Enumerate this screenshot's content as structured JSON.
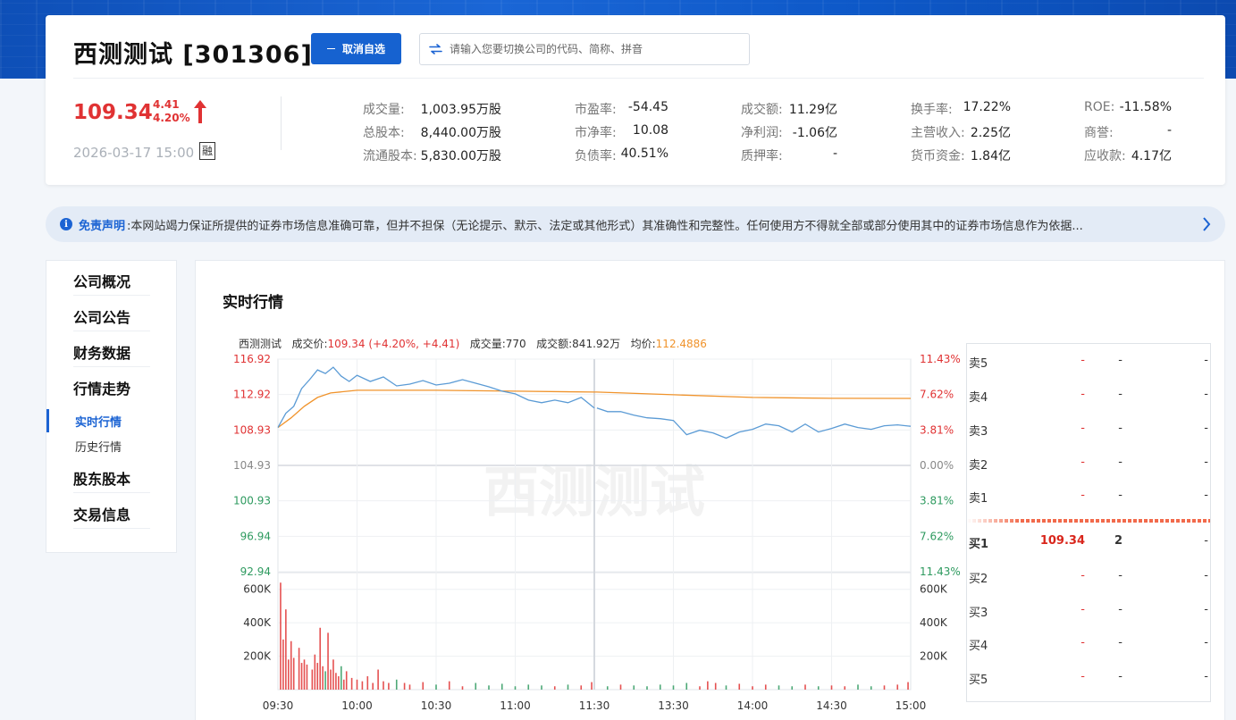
{
  "header": {
    "title": "西测测试 [301306]",
    "cancel_label": "取消自选",
    "search_placeholder": "请输入您要切换公司的代码、简称、拼音"
  },
  "quote": {
    "price": "109.34",
    "change": "4.41",
    "change_pct": "4.20%",
    "datetime": "2026-03-17 15:00",
    "margin_badge": "融"
  },
  "metrics": [
    [
      {
        "label": "成交量:",
        "value": "1,003.95万股"
      },
      {
        "label": "总股本:",
        "value": "8,440.00万股"
      },
      {
        "label": "流通股本:",
        "value": "5,830.00万股"
      }
    ],
    [
      {
        "label": "市盈率:",
        "value": "-54.45"
      },
      {
        "label": "市净率:",
        "value": "10.08"
      },
      {
        "label": "负债率:",
        "value": "40.51%"
      }
    ],
    [
      {
        "label": "成交额:",
        "value": "11.29亿"
      },
      {
        "label": "净利润:",
        "value": "-1.06亿"
      },
      {
        "label": "质押率:",
        "value": "-"
      }
    ],
    [
      {
        "label": "换手率:",
        "value": "17.22%"
      },
      {
        "label": "主营收入:",
        "value": "2.25亿"
      },
      {
        "label": "货币资金:",
        "value": "1.84亿"
      }
    ],
    [
      {
        "label": "ROE:",
        "value": "-11.58%"
      },
      {
        "label": "商誉:",
        "value": "-"
      },
      {
        "label": "应收款:",
        "value": "4.17亿"
      }
    ]
  ],
  "notice": {
    "title": "免责声明",
    "text": ":本网站竭力保证所提供的证券市场信息准确可靠，但并不担保（无论提示、默示、法定或其他形式）其准确性和完整性。任何使用方不得就全部或部分使用其中的证券市场信息作为依据..."
  },
  "sidebar": {
    "items": [
      "公司概况",
      "公司公告",
      "财务数据",
      "行情走势",
      "股东股本",
      "交易信息"
    ],
    "subitems": [
      "实时行情",
      "历史行情"
    ]
  },
  "main": {
    "section_title": "实时行情",
    "info": {
      "name": "西测测试",
      "price_label": "成交价:",
      "price_value": "109.34 (+4.20%, +4.41)",
      "volume_label": "成交量:",
      "volume_value": "770",
      "amount_label": "成交额:",
      "amount_value": "841.92万",
      "avg_label": "均价:",
      "avg_value": "112.4886"
    },
    "watermark": "西测测试"
  },
  "colors": {
    "up": "#e03233",
    "down": "#2e9a5f",
    "accent": "#1b63d3",
    "price_line": "#5b9bd5",
    "avg_line": "#f0932b"
  },
  "icons": [
    "arrow-up-icon",
    "swap-icon",
    "minus-icon",
    "info-icon",
    "chevron-right-icon"
  ],
  "chart_data": {
    "type": "line",
    "price_axis": {
      "labels": [
        "116.92",
        "112.92",
        "108.93",
        "104.93",
        "100.93",
        "96.94",
        "92.94"
      ],
      "ylim": [
        92.94,
        116.92
      ],
      "base": 104.93
    },
    "pct_axis": {
      "labels": [
        "11.43%",
        "7.62%",
        "3.81%",
        "0.00%",
        "3.81%",
        "7.62%",
        "11.43%"
      ]
    },
    "volume_axis": {
      "labels": [
        "600K",
        "400K",
        "200K"
      ],
      "ylim": [
        0,
        700000
      ]
    },
    "x_labels": [
      "09:30",
      "10:00",
      "10:30",
      "11:00",
      "11:30",
      "13:30",
      "14:00",
      "14:30",
      "15:00"
    ],
    "series": [
      {
        "type": "line",
        "values": [
          [
            0,
            109.2
          ],
          [
            3,
            110.8
          ],
          [
            6,
            111.6
          ],
          [
            9,
            113.6
          ],
          [
            12,
            114.6
          ],
          [
            15,
            115.7
          ],
          [
            18,
            115.3
          ],
          [
            21,
            116.0
          ],
          [
            24,
            115.0
          ],
          [
            27,
            114.4
          ],
          [
            30,
            115.1
          ],
          [
            35,
            114.4
          ],
          [
            40,
            114.9
          ],
          [
            45,
            113.9
          ],
          [
            50,
            114.1
          ],
          [
            55,
            114.5
          ],
          [
            60,
            114.0
          ],
          [
            65,
            114.2
          ],
          [
            70,
            114.6
          ],
          [
            75,
            114.2
          ],
          [
            80,
            113.8
          ],
          [
            85,
            113.3
          ],
          [
            90,
            113.0
          ],
          [
            95,
            112.3
          ],
          [
            100,
            112.0
          ],
          [
            105,
            112.3
          ],
          [
            110,
            112.0
          ],
          [
            115,
            112.6
          ],
          [
            120,
            111.4
          ],
          [
            121,
            111.4
          ],
          [
            125,
            111.0
          ],
          [
            130,
            111.0
          ],
          [
            135,
            110.6
          ],
          [
            140,
            110.3
          ],
          [
            145,
            110.2
          ],
          [
            150,
            110.0
          ],
          [
            155,
            108.4
          ],
          [
            160,
            108.9
          ],
          [
            165,
            108.6
          ],
          [
            170,
            108.0
          ],
          [
            175,
            108.7
          ],
          [
            180,
            109.0
          ],
          [
            185,
            109.6
          ],
          [
            190,
            109.4
          ],
          [
            195,
            108.7
          ],
          [
            200,
            109.6
          ],
          [
            205,
            108.7
          ],
          [
            210,
            109.1
          ],
          [
            215,
            109.6
          ],
          [
            220,
            109.2
          ],
          [
            225,
            109.0
          ],
          [
            230,
            109.4
          ],
          [
            235,
            109.5
          ],
          [
            240,
            109.34
          ]
        ]
      },
      {
        "type": "line",
        "values": [
          [
            0,
            109.2
          ],
          [
            5,
            110.3
          ],
          [
            10,
            111.6
          ],
          [
            15,
            112.6
          ],
          [
            20,
            113.1
          ],
          [
            30,
            113.4
          ],
          [
            60,
            113.4
          ],
          [
            90,
            113.3
          ],
          [
            120,
            113.2
          ],
          [
            121,
            113.2
          ],
          [
            150,
            112.9
          ],
          [
            180,
            112.6
          ],
          [
            210,
            112.5
          ],
          [
            240,
            112.49
          ]
        ]
      },
      {
        "type": "bar",
        "values": [
          [
            1,
            640000
          ],
          [
            2,
            300000
          ],
          [
            3,
            480000
          ],
          [
            4,
            180000
          ],
          [
            5,
            290000
          ],
          [
            6,
            190000
          ],
          [
            8,
            250000
          ],
          [
            9,
            160000
          ],
          [
            10,
            180000
          ],
          [
            11,
            150000
          ],
          [
            13,
            120000
          ],
          [
            14,
            210000
          ],
          [
            15,
            160000
          ],
          [
            16,
            370000
          ],
          [
            17,
            140000
          ],
          [
            18,
            110000
          ],
          [
            19,
            340000
          ],
          [
            20,
            120000
          ],
          [
            21,
            180000
          ],
          [
            22,
            100000
          ],
          [
            23,
            80000
          ],
          [
            24,
            140000
          ],
          [
            25,
            60000
          ],
          [
            26,
            110000
          ],
          [
            28,
            70000
          ],
          [
            30,
            60000
          ],
          [
            32,
            50000
          ],
          [
            34,
            80000
          ],
          [
            36,
            40000
          ],
          [
            38,
            120000
          ],
          [
            40,
            50000
          ],
          [
            42,
            40000
          ],
          [
            45,
            60000
          ],
          [
            48,
            40000
          ],
          [
            50,
            30000
          ],
          [
            55,
            45000
          ],
          [
            60,
            30000
          ],
          [
            65,
            50000
          ],
          [
            70,
            20000
          ],
          [
            75,
            40000
          ],
          [
            80,
            25000
          ],
          [
            85,
            35000
          ],
          [
            90,
            20000
          ],
          [
            95,
            30000
          ],
          [
            100,
            25000
          ],
          [
            105,
            20000
          ],
          [
            110,
            30000
          ],
          [
            115,
            25000
          ],
          [
            119,
            45000
          ],
          [
            125,
            20000
          ],
          [
            130,
            30000
          ],
          [
            135,
            25000
          ],
          [
            140,
            20000
          ],
          [
            145,
            30000
          ],
          [
            150,
            25000
          ],
          [
            155,
            40000
          ],
          [
            160,
            20000
          ],
          [
            163,
            50000
          ],
          [
            166,
            40000
          ],
          [
            170,
            25000
          ],
          [
            175,
            35000
          ],
          [
            180,
            20000
          ],
          [
            185,
            30000
          ],
          [
            190,
            25000
          ],
          [
            195,
            20000
          ],
          [
            200,
            30000
          ],
          [
            205,
            20000
          ],
          [
            210,
            25000
          ],
          [
            215,
            20000
          ],
          [
            220,
            30000
          ],
          [
            225,
            20000
          ],
          [
            230,
            25000
          ],
          [
            235,
            30000
          ],
          [
            239,
            45000
          ]
        ]
      }
    ]
  },
  "orderbook": {
    "asks": [
      {
        "label": "卖5",
        "price": "-",
        "volume": "-",
        "extra": "-"
      },
      {
        "label": "卖4",
        "price": "-",
        "volume": "-",
        "extra": "-"
      },
      {
        "label": "卖3",
        "price": "-",
        "volume": "-",
        "extra": "-"
      },
      {
        "label": "卖2",
        "price": "-",
        "volume": "-",
        "extra": "-"
      },
      {
        "label": "卖1",
        "price": "-",
        "volume": "-",
        "extra": "-"
      }
    ],
    "bids": [
      {
        "label": "买1",
        "price": "109.34",
        "volume": "2",
        "extra": "-"
      },
      {
        "label": "买2",
        "price": "-",
        "volume": "-",
        "extra": "-"
      },
      {
        "label": "买3",
        "price": "-",
        "volume": "-",
        "extra": "-"
      },
      {
        "label": "买4",
        "price": "-",
        "volume": "-",
        "extra": "-"
      },
      {
        "label": "买5",
        "price": "-",
        "volume": "-",
        "extra": "-"
      }
    ]
  }
}
